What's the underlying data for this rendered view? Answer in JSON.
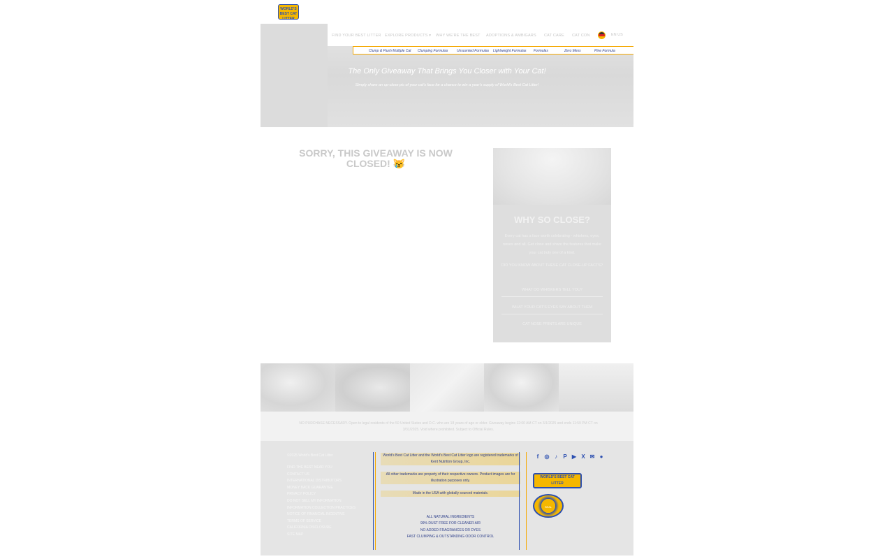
{
  "brand": {
    "logo_text": "WORLD'S BEST CAT LITTER"
  },
  "nav": {
    "items": [
      {
        "label": "FIND YOUR BEST LITTER"
      },
      {
        "label": "EXPLORE PRODUCTS ▾"
      },
      {
        "label": "WHY WE'RE THE BEST"
      },
      {
        "label": "ADOPTIONS & AMBIGARS"
      },
      {
        "label": "CAT CARE"
      },
      {
        "label": "CAT CON"
      }
    ],
    "lang": "EN US"
  },
  "subnav": {
    "items": [
      "Clump & Flush Multiple Cat",
      "Clumping Formulas",
      "Unscented Formulas",
      "Lightweight Formulas",
      "Formulas",
      "Zero Mess",
      "Pine Formula"
    ]
  },
  "hero": {
    "tagline": "The Only Giveaway That Brings You Closer with Your Cat!",
    "subtitle": "Simply share an up-close pic of your cat's face for a chance to win a year's supply of World's Best Cat Litter!"
  },
  "main": {
    "closed_heading": "SORRY, THIS GIVEAWAY IS NOW CLOSED! 😿"
  },
  "card": {
    "title": "WHY SO CLOSE?",
    "text": "Every cat has a face worth celebrating - whiskers, eyes, noses and all. Get close and share the features that make your cat truly one of a kind.",
    "question": "DID YOU KNOW ABOUT THESE CAT CLOSE-UP FACTS?",
    "links": [
      "WHAT DO WHISKERS TELL YOU?",
      "WHAT YOUR CAT'S EYES SAY ABOUT THEM",
      "CAT NOSE PRINTS ARE UNIQUE"
    ]
  },
  "disclaimer": {
    "text": "NO PURCHASE NECESSARY. Open to legal residents of the 50 United States and D.C. who are 18 years of age or older. Giveaway begins 12:00 AM CT on 3/1/2025 and ends 11:59 PM CT on 3/31/2025. Void where prohibited. Subject to Official Rules."
  },
  "footer": {
    "copyright": "©2025 World's Best Cat Litter",
    "links": [
      "FIND THE BEST NEAR YOU",
      "CONTACT US",
      "INTERNATIONAL DISTRIBUTORS",
      "MONEY BACK GUARANTEE",
      "PRIVACY POLICY",
      "DO NOT SELL MY INFORMATION",
      "INFORMATION COLLECTION PRACTICES",
      "NOTICE OF FINANCIAL INCENTIVE",
      "TERMS OF SERVICE",
      "CALIFORNIA DISCLOSURE",
      "SITE MAP"
    ],
    "mid_text_1": "World's Best Cat Litter and the World's Best Cat Litter logo are registered trademarks of Kent Nutrition Group, Inc.",
    "mid_text_2": "All other trademarks are property of their respective owners. Product images are for illustration purposes only.",
    "mid_text_3": "Made in the USA with globally sourced materials.",
    "mid_links": [
      "ALL NATURAL INGREDIENTS",
      "99% DUST FREE FOR CLEANER AIR",
      "NO ADDED FRAGRANCES OR DYES",
      "FAST CLUMPING & OUTSTANDING ODOR CONTROL"
    ],
    "social_icons": [
      "facebook-icon",
      "instagram-icon",
      "tiktok-icon",
      "pinterest-icon",
      "youtube-icon",
      "x-icon",
      "email-icon",
      "chat-icon"
    ],
    "badge_text": "WORLD'S BEST CAT LITTER",
    "seal_text": "SEAL"
  },
  "colors": {
    "brand_blue": "#2c4fb0",
    "brand_gold": "#f5a800"
  }
}
